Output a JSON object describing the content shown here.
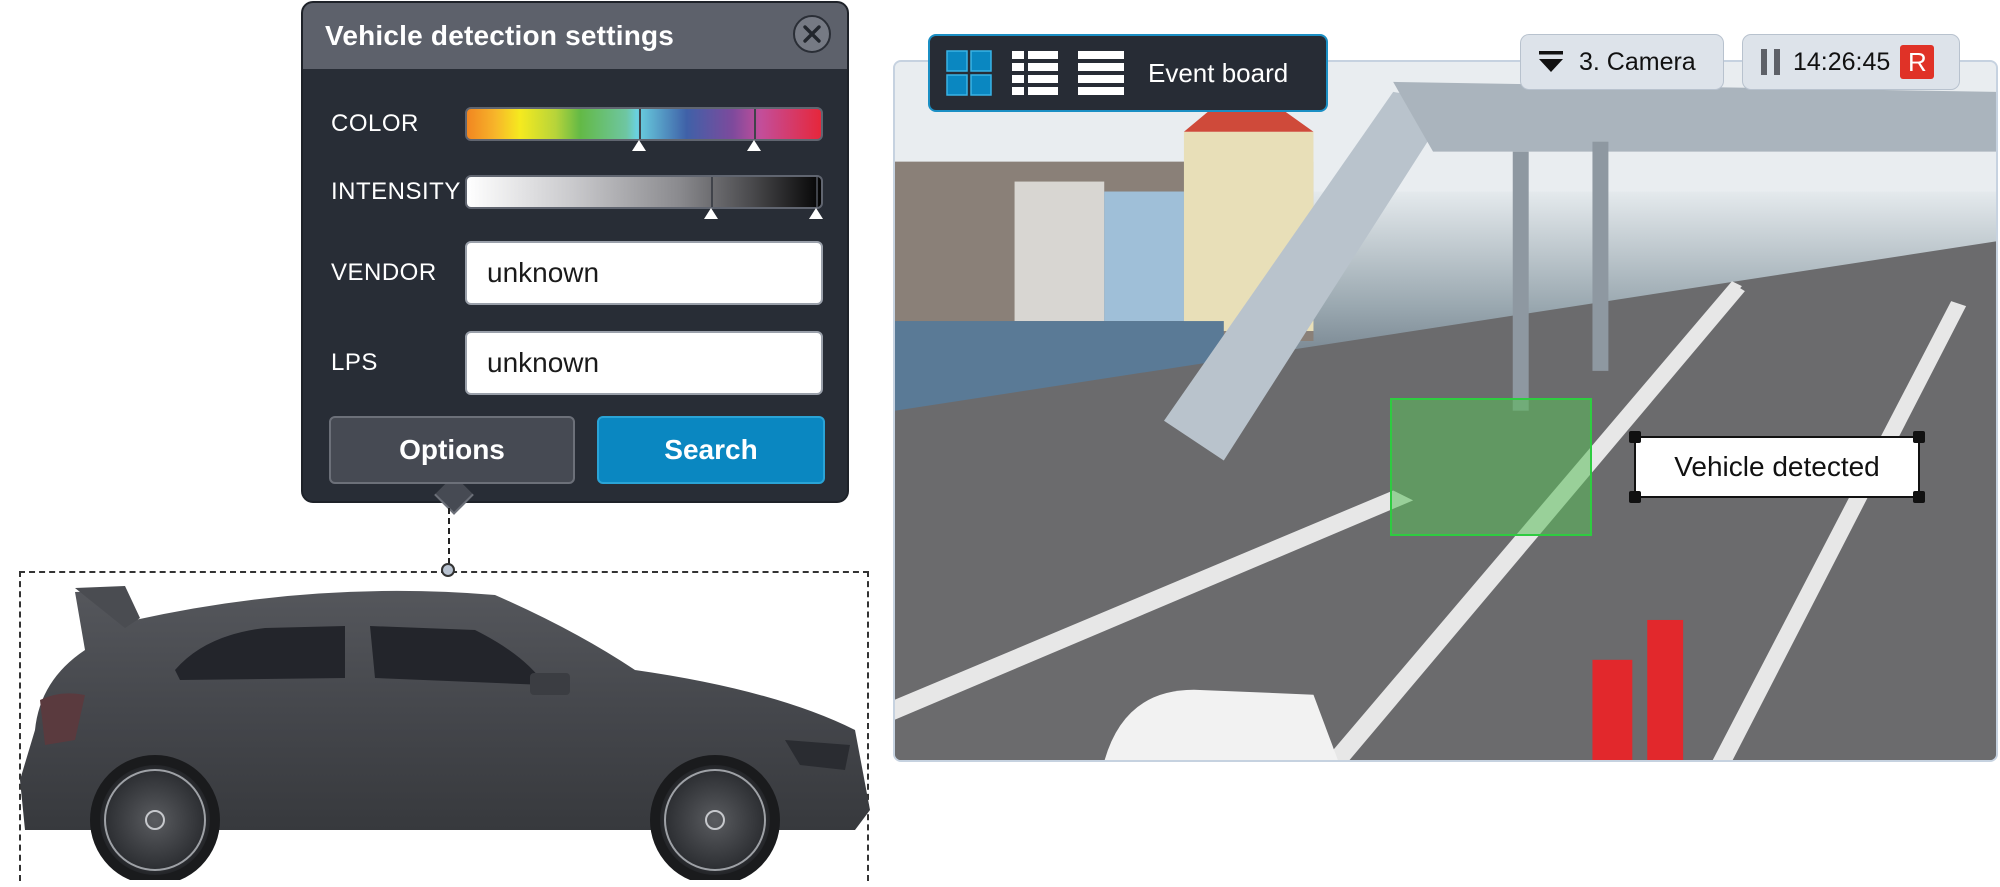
{
  "settings_panel": {
    "title": "Vehicle detection settings",
    "close_icon": "close-icon",
    "color": {
      "label": "COLOR",
      "range_start": 0.485,
      "range_end": 0.81
    },
    "intensity": {
      "label": "INTENSITY",
      "range_start": 0.69,
      "range_end": 0.985
    },
    "vendor": {
      "label": "VENDOR",
      "value": "unknown"
    },
    "lps": {
      "label": "LPS",
      "value": "unknown"
    },
    "options_label": "Options",
    "search_label": "Search",
    "accent_color": "#0a87c1"
  },
  "camera_view": {
    "toolbar": {
      "view_icons": [
        "grid-view-icon",
        "detailed-list-icon",
        "list-view-icon"
      ],
      "active_view": "grid-view-icon",
      "title": "Event board"
    },
    "camera_selector": {
      "icon": "dropdown-icon",
      "label": "3. Camera"
    },
    "playback": {
      "icon": "pause-icon",
      "time": "14:26:45",
      "record_badge": "R",
      "record_color": "#e03227"
    },
    "detection": {
      "label": "Vehicle detected",
      "box_color": "#2ecc40"
    }
  }
}
